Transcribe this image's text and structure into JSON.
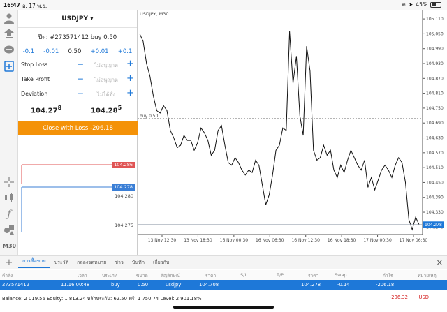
{
  "statusbar": {
    "time": "16:47",
    "date": "อ. 17 พ.ย.",
    "battery": "45%",
    "battery_level": 0.45
  },
  "panel": {
    "symbol": "USDJPY",
    "ticket": "ปิด: #273571412 buy 0.50",
    "steps": [
      "-0.1",
      "-0.01",
      "0.50",
      "+0.01",
      "+0.1"
    ],
    "stop_loss": {
      "label": "Stop Loss",
      "value": "ไม่อนุญาต"
    },
    "take_profit": {
      "label": "Take Profit",
      "value": "ไม่อนุญาต"
    },
    "deviation": {
      "label": "Deviation",
      "value": "ไม่ได้ตั้ง"
    },
    "bid": {
      "main": "104.27",
      "pip": "8"
    },
    "ask": {
      "main": "104.28",
      "pip": "5"
    },
    "close_button": "Close with Loss -206.18",
    "mini": {
      "ask_tag": "104.286",
      "bid_tag": "104.278",
      "lvl1": "104.280",
      "lvl2": "104.275"
    }
  },
  "chart": {
    "title": "USDJPY, M30",
    "order_line_label": "buy 0.50",
    "last_price_tag": "104.278"
  },
  "chart_data": {
    "type": "line",
    "title": "USDJPY, M30",
    "x_ticks": [
      "13 Nov 12:30",
      "13 Nov 18:30",
      "16 Nov 00:30",
      "16 Nov 06:30",
      "16 Nov 12:30",
      "16 Nov 18:30",
      "17 Nov 00:30",
      "17 Nov 06:30"
    ],
    "y_ticks": [
      "105.110",
      "105.050",
      "104.990",
      "104.930",
      "104.870",
      "104.810",
      "104.750",
      "104.690",
      "104.630",
      "104.570",
      "104.510",
      "104.450",
      "104.390",
      "104.330",
      "104.270"
    ],
    "ylim": [
      104.24,
      105.13
    ],
    "order_level": 104.708,
    "values": [
      105.05,
      105.02,
      104.93,
      104.88,
      104.8,
      104.74,
      104.73,
      104.76,
      104.74,
      104.66,
      104.63,
      104.59,
      104.6,
      104.64,
      104.62,
      104.62,
      104.58,
      104.61,
      104.67,
      104.65,
      104.62,
      104.56,
      104.58,
      104.66,
      104.68,
      104.6,
      104.53,
      104.52,
      104.55,
      104.53,
      104.5,
      104.48,
      104.5,
      104.49,
      104.54,
      104.52,
      104.44,
      104.36,
      104.4,
      104.48,
      104.58,
      104.6,
      104.67,
      104.66,
      105.06,
      104.85,
      104.96,
      104.72,
      104.64,
      105.0,
      104.9,
      104.58,
      104.54,
      104.55,
      104.6,
      104.56,
      104.58,
      104.5,
      104.47,
      104.52,
      104.49,
      104.54,
      104.58,
      104.55,
      104.52,
      104.5,
      104.54,
      104.43,
      104.47,
      104.42,
      104.46,
      104.5,
      104.52,
      104.5,
      104.47,
      104.52,
      104.55,
      104.53,
      104.45,
      104.3,
      104.26,
      104.31,
      104.28
    ]
  },
  "tabs": {
    "items": [
      "การซื้อขาย",
      "ประวัติ",
      "กล่องจดหมาย",
      "ข่าว",
      "บันทึก",
      "เกี่ยวกับ"
    ]
  },
  "table": {
    "headers": [
      "คำสั่ง",
      "เวลา",
      "ประเภท",
      "ขนาด",
      "สัญลักษณ์",
      "ราคา",
      "S/L",
      "T/P",
      "ราคา",
      "Swap",
      "กำไร",
      "หมายเหตุ"
    ],
    "row": [
      "273571412",
      "11.16 00:48",
      "buy",
      "0.50",
      "usdjpy",
      "104.708",
      "",
      "",
      "104.278",
      "-0.14",
      "-206.18",
      ""
    ]
  },
  "balance": {
    "text": "Balance: 2 019.56 Equity: 1 813.24 หลักประกัน: 62.50 ฟรี: 1 750.74 Level: 2 901.18%",
    "pl": "-206.32",
    "currency": "USD"
  }
}
